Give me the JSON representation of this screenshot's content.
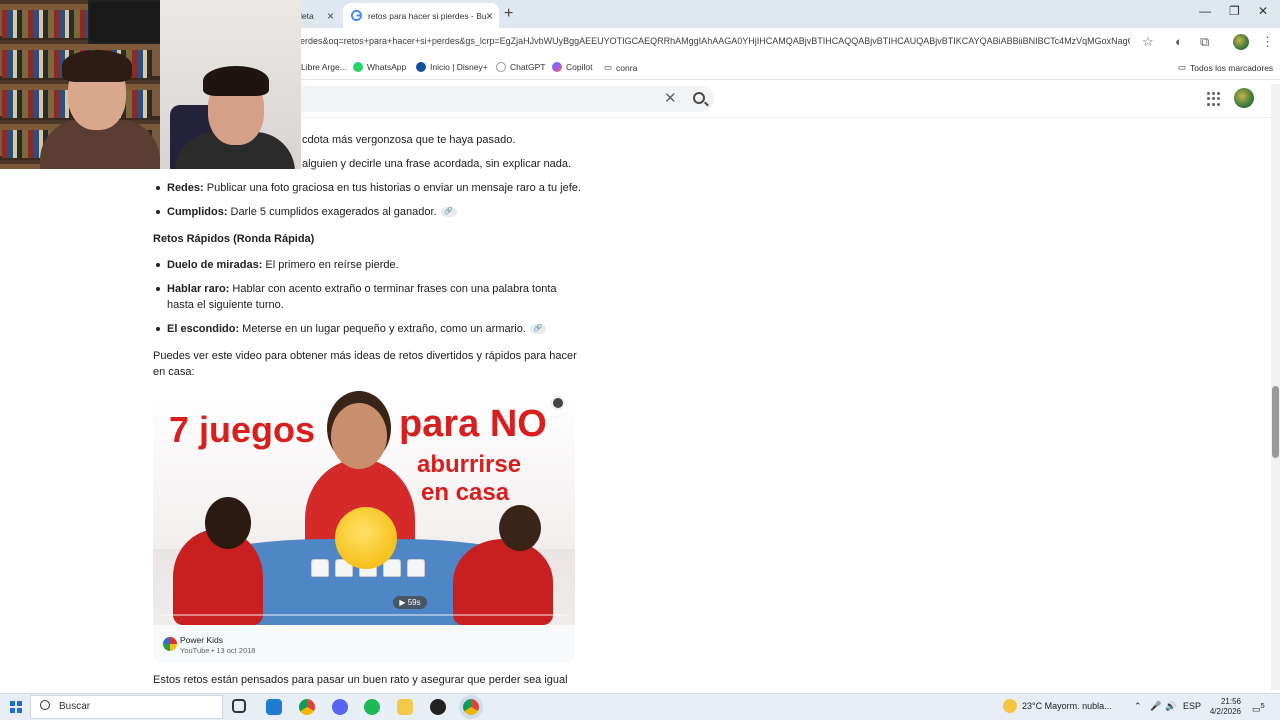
{
  "browser": {
    "tabs": [
      {
        "label": "leta",
        "active": false
      },
      {
        "label": "retos para hacer si pierdes - Bu",
        "active": true
      }
    ],
    "url": "erdes&oq=retos+para+hacer+si+perdes&gs_lcrp=EgZjaHJvbWUyBggAEEUYOTIGCAEQRRhAMggIAhAAGA0YHjIHCAMQABjvBTIHCAQQABjvBTIHCAUQABjvBTIKCAYQABiABBiiBNIBCTc4MzVqMGoxNagC...",
    "bookmarks": [
      "Libre Arge...",
      "WhatsApp",
      "Inicio | Disney+",
      "ChatGPT",
      "Copilot",
      "conra"
    ],
    "bookmarks_right": "Todos los marcadores"
  },
  "content": {
    "line1": "cdota más vergonzosa que te haya pasado.",
    "line2": "alguien y decirle una frase acordada, sin explicar nada.",
    "items_a": [
      {
        "bold": "Redes:",
        "text": " Publicar una foto graciosa en tus historias o enviar un mensaje raro a tu jefe."
      },
      {
        "bold": "Cumplidos:",
        "text": " Darle 5 cumplidos exagerados al ganador."
      }
    ],
    "heading": "Retos Rápidos (Ronda Rápida)",
    "items_b": [
      {
        "bold": "Duelo de miradas:",
        "text": " El primero en reírse pierde."
      },
      {
        "bold": "Hablar raro:",
        "text": " Hablar con acento extraño o terminar frases con una palabra tonta",
        "text2": "hasta el siguiente turno."
      },
      {
        "bold": "El escondido:",
        "text": " Meterse en un lugar pequeño y extraño, como un armario."
      }
    ],
    "intro_1": "Puedes ver este video para obtener más ideas de retos divertidos y rápidos para hacer",
    "intro_2": "en casa:",
    "outro": "Estos retos están pensados para pasar un buen rato y asegurar que perder sea igual"
  },
  "video": {
    "title_left": "7 juegos",
    "title_right_1": "para NO",
    "title_right_2": "aburrirse",
    "title_right_3": "en casa",
    "duration": "▶ 59s",
    "progress": 0.0,
    "channel": "Power Kids",
    "source": "YouTube • 13 oct 2018"
  },
  "taskbar": {
    "search_label": "Buscar",
    "weather": "23°C  Mayorm. nubla...",
    "lang": "ESP",
    "time": "21:56",
    "date": "4/2/2026",
    "notifications": "5"
  },
  "colors": {
    "accent": "#1a73e8",
    "taskbar": "#e8eef6",
    "video_title_red": "#d91e1e"
  }
}
